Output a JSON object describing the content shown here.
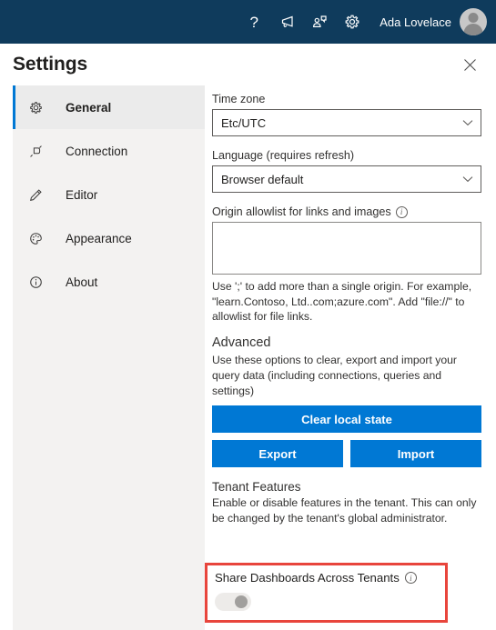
{
  "appbar": {
    "icons": [
      {
        "name": "help-icon",
        "glyph": "?"
      },
      {
        "name": "announcements-megaphone-icon"
      },
      {
        "name": "feedback-icon"
      },
      {
        "name": "settings-gear-icon"
      }
    ],
    "user_name": "Ada Lovelace",
    "background": "#0f3b5c"
  },
  "panel": {
    "title": "Settings",
    "close_label": "✕"
  },
  "sidebar": {
    "items": [
      {
        "label": "General",
        "icon": "gear-icon",
        "active": true
      },
      {
        "label": "Connection",
        "icon": "plug-icon",
        "active": false
      },
      {
        "label": "Editor",
        "icon": "pencil-icon",
        "active": false
      },
      {
        "label": "Appearance",
        "icon": "palette-icon",
        "active": false
      },
      {
        "label": "About",
        "icon": "info-circle-icon",
        "active": false
      }
    ],
    "accent_color": "#0078d4",
    "background": "#f3f2f1"
  },
  "general": {
    "timezone": {
      "label": "Time zone",
      "value": "Etc/UTC"
    },
    "language": {
      "label": "Language (requires refresh)",
      "value": "Browser default"
    },
    "origin_allowlist": {
      "label": "Origin allowlist for links and images",
      "value": "",
      "placeholder": "",
      "hint": "Use ';' to add more than a single origin. For example, \"learn.Contoso, Ltd..com;azure.com\". Add \"file://\" to allowlist for file links."
    },
    "advanced": {
      "heading": "Advanced",
      "description": "Use these options to clear, export and import your query data (including connections, queries and settings)",
      "clear_button": "Clear local state",
      "export_button": "Export",
      "import_button": "Import",
      "button_color": "#0078d4"
    },
    "tenant_features": {
      "heading": "Tenant Features",
      "description": "Enable or disable features in the tenant. This can only be changed by the tenant's global administrator.",
      "toggle_label": "Share Dashboards Across Tenants",
      "toggle_state": "off",
      "highlight_color": "#e8453c"
    }
  }
}
